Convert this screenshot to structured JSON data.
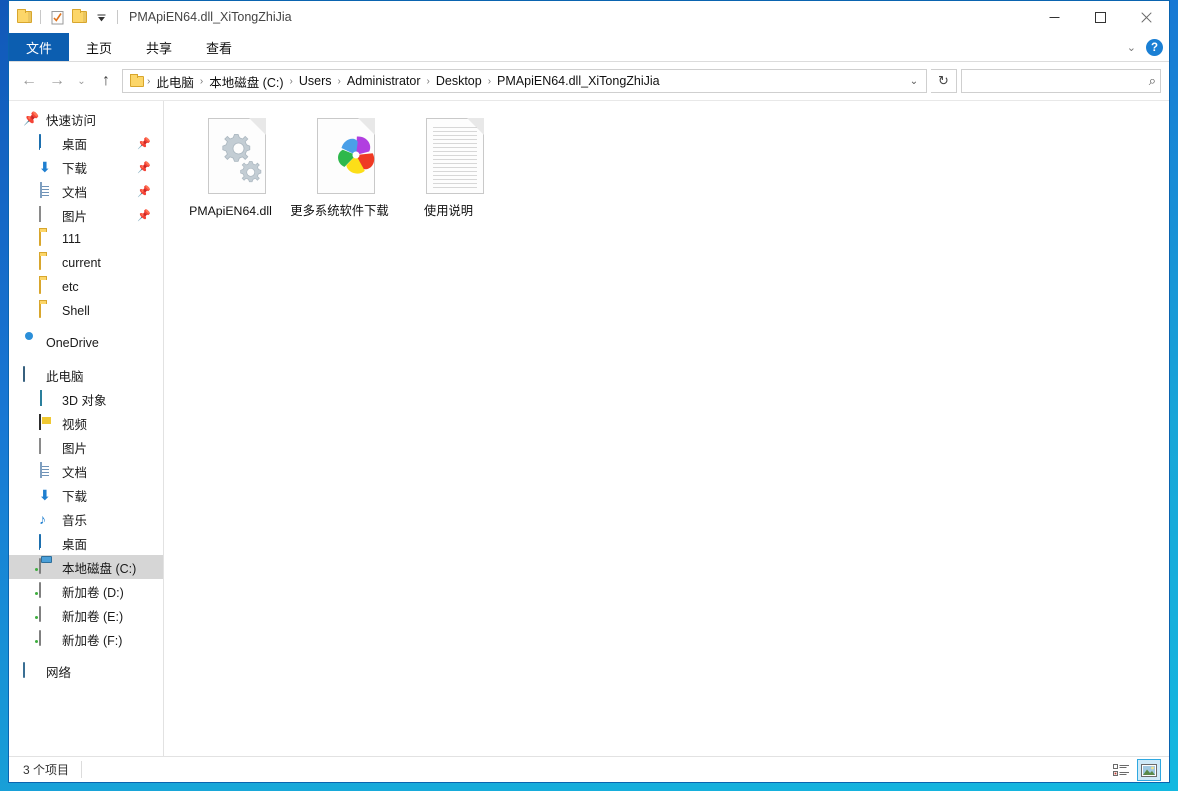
{
  "window": {
    "title": "PMApiEN64.dll_XiTongZhiJia",
    "quick_access": [
      {
        "name": "folder-icon",
        "label": "文件夹"
      },
      {
        "name": "properties-icon",
        "label": "属性"
      },
      {
        "name": "new-folder-icon",
        "label": "新建文件夹"
      },
      {
        "name": "customize-dropdown-icon",
        "label": "自定义快速访问工具栏"
      }
    ],
    "controls": {
      "minimize": "—",
      "maximize": "□",
      "close": "✕"
    }
  },
  "ribbon": {
    "tabs": [
      {
        "label": "文件",
        "active": true
      },
      {
        "label": "主页",
        "active": false
      },
      {
        "label": "共享",
        "active": false
      },
      {
        "label": "查看",
        "active": false
      }
    ],
    "expand_icon": "⌄",
    "help_icon": "?"
  },
  "address": {
    "back_icon": "←",
    "forward_icon": "→",
    "recent_icon": "⌄",
    "up_icon": "↑",
    "breadcrumbs": [
      "此电脑",
      "本地磁盘 (C:)",
      "Users",
      "Administrator",
      "Desktop",
      "PMApiEN64.dll_XiTongZhiJia"
    ],
    "separator": "›",
    "dropdown_icon": "⌄",
    "refresh_icon": "↻",
    "search_value": "",
    "search_placeholder": "",
    "search_icon": "⌕"
  },
  "sidebar": {
    "groups": [
      {
        "header": {
          "label": "快速访问",
          "icon": "pin-star-icon",
          "name": "sidebar-item-quick-access"
        },
        "items": [
          {
            "label": "桌面",
            "icon": "desktop-icon",
            "pinned": true,
            "name": "sidebar-item-desktop-qa"
          },
          {
            "label": "下载",
            "icon": "downloads-icon",
            "pinned": true,
            "name": "sidebar-item-downloads-qa"
          },
          {
            "label": "文档",
            "icon": "documents-icon",
            "pinned": true,
            "name": "sidebar-item-documents-qa"
          },
          {
            "label": "图片",
            "icon": "pictures-icon",
            "pinned": true,
            "name": "sidebar-item-pictures-qa"
          },
          {
            "label": "111",
            "icon": "folder-icon",
            "pinned": false,
            "name": "sidebar-item-111"
          },
          {
            "label": "current",
            "icon": "folder-icon",
            "pinned": false,
            "name": "sidebar-item-current"
          },
          {
            "label": "etc",
            "icon": "folder-icon",
            "pinned": false,
            "name": "sidebar-item-etc"
          },
          {
            "label": "Shell",
            "icon": "folder-icon",
            "pinned": false,
            "name": "sidebar-item-shell"
          }
        ]
      },
      {
        "header": {
          "label": "OneDrive",
          "icon": "cloud-icon",
          "name": "sidebar-item-onedrive"
        },
        "items": []
      },
      {
        "header": {
          "label": "此电脑",
          "icon": "this-pc-icon",
          "name": "sidebar-item-this-pc"
        },
        "items": [
          {
            "label": "3D 对象",
            "icon": "3d-objects-icon",
            "pinned": false,
            "name": "sidebar-item-3d-objects"
          },
          {
            "label": "视频",
            "icon": "videos-icon",
            "pinned": false,
            "name": "sidebar-item-videos"
          },
          {
            "label": "图片",
            "icon": "pictures-icon",
            "pinned": false,
            "name": "sidebar-item-pictures"
          },
          {
            "label": "文档",
            "icon": "documents-icon",
            "pinned": false,
            "name": "sidebar-item-documents"
          },
          {
            "label": "下载",
            "icon": "downloads-icon",
            "pinned": false,
            "name": "sidebar-item-downloads"
          },
          {
            "label": "音乐",
            "icon": "music-icon",
            "pinned": false,
            "name": "sidebar-item-music"
          },
          {
            "label": "桌面",
            "icon": "desktop-icon",
            "pinned": false,
            "name": "sidebar-item-desktop"
          },
          {
            "label": "本地磁盘 (C:)",
            "icon": "system-drive-icon",
            "pinned": false,
            "selected": true,
            "name": "sidebar-item-local-disk-c"
          },
          {
            "label": "新加卷 (D:)",
            "icon": "drive-icon",
            "pinned": false,
            "name": "sidebar-item-volume-d"
          },
          {
            "label": "新加卷 (E:)",
            "icon": "drive-icon",
            "pinned": false,
            "name": "sidebar-item-volume-e"
          },
          {
            "label": "新加卷 (F:)",
            "icon": "drive-icon",
            "pinned": false,
            "name": "sidebar-item-volume-f"
          }
        ]
      },
      {
        "header": {
          "label": "网络",
          "icon": "network-icon",
          "name": "sidebar-item-network"
        },
        "items": []
      }
    ],
    "pin_glyph": "📌"
  },
  "files": [
    {
      "name": "PMApiEN64.dll",
      "icon": "dll-gears-icon"
    },
    {
      "name": "更多系统软件下载",
      "icon": "browser-pinwheel-icon"
    },
    {
      "name": "使用说明",
      "icon": "text-document-icon"
    }
  ],
  "status": {
    "item_count": "3 个项目",
    "views": [
      {
        "name": "details-view-button",
        "active": false
      },
      {
        "name": "large-icons-view-button",
        "active": true
      }
    ]
  },
  "colors": {
    "accent": "#0c5eb0",
    "selection": "#d6d6d6",
    "folder": "#fcd669",
    "help": "#1a7fd4",
    "view_active": "#2fa8e0"
  }
}
